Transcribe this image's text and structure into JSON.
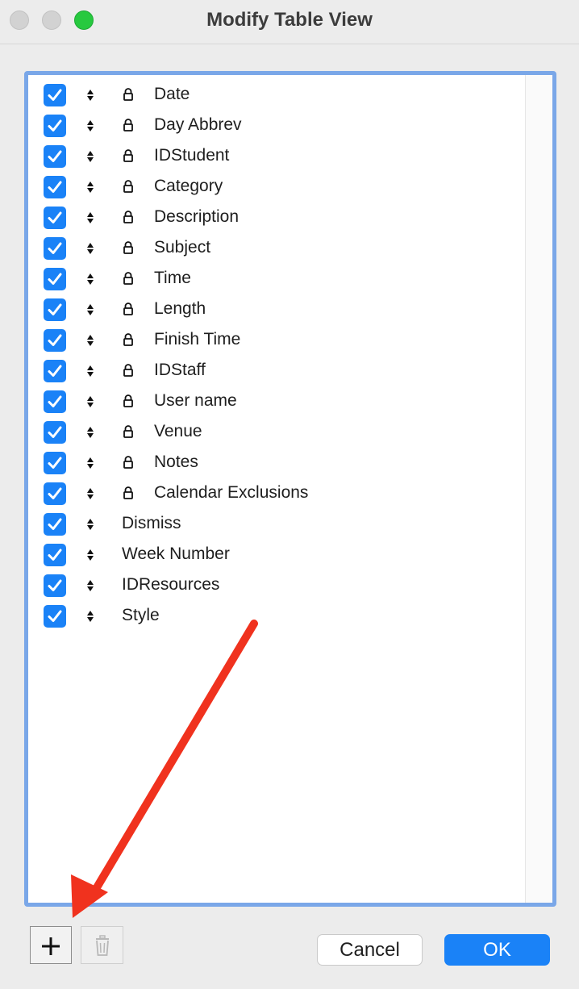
{
  "window": {
    "title": "Modify Table View"
  },
  "fields": [
    {
      "label": "Date",
      "checked": true,
      "locked": true
    },
    {
      "label": "Day Abbrev",
      "checked": true,
      "locked": true
    },
    {
      "label": "IDStudent",
      "checked": true,
      "locked": true
    },
    {
      "label": "Category",
      "checked": true,
      "locked": true
    },
    {
      "label": "Description",
      "checked": true,
      "locked": true
    },
    {
      "label": "Subject",
      "checked": true,
      "locked": true
    },
    {
      "label": "Time",
      "checked": true,
      "locked": true
    },
    {
      "label": "Length",
      "checked": true,
      "locked": true
    },
    {
      "label": "Finish Time",
      "checked": true,
      "locked": true
    },
    {
      "label": "IDStaff",
      "checked": true,
      "locked": true
    },
    {
      "label": "User name",
      "checked": true,
      "locked": true
    },
    {
      "label": "Venue",
      "checked": true,
      "locked": true
    },
    {
      "label": "Notes",
      "checked": true,
      "locked": true
    },
    {
      "label": "Calendar Exclusions",
      "checked": true,
      "locked": true
    },
    {
      "label": "Dismiss",
      "checked": true,
      "locked": false
    },
    {
      "label": "Week Number",
      "checked": true,
      "locked": false
    },
    {
      "label": "IDResources",
      "checked": true,
      "locked": false
    },
    {
      "label": "Style",
      "checked": true,
      "locked": false
    }
  ],
  "buttons": {
    "add_icon": "plus-icon",
    "delete_icon": "trash-icon",
    "cancel_label": "Cancel",
    "ok_label": "OK"
  },
  "colors": {
    "accent": "#1a82f7",
    "frame_border": "#7aa7e8",
    "annotation_arrow": "#f0321e"
  }
}
